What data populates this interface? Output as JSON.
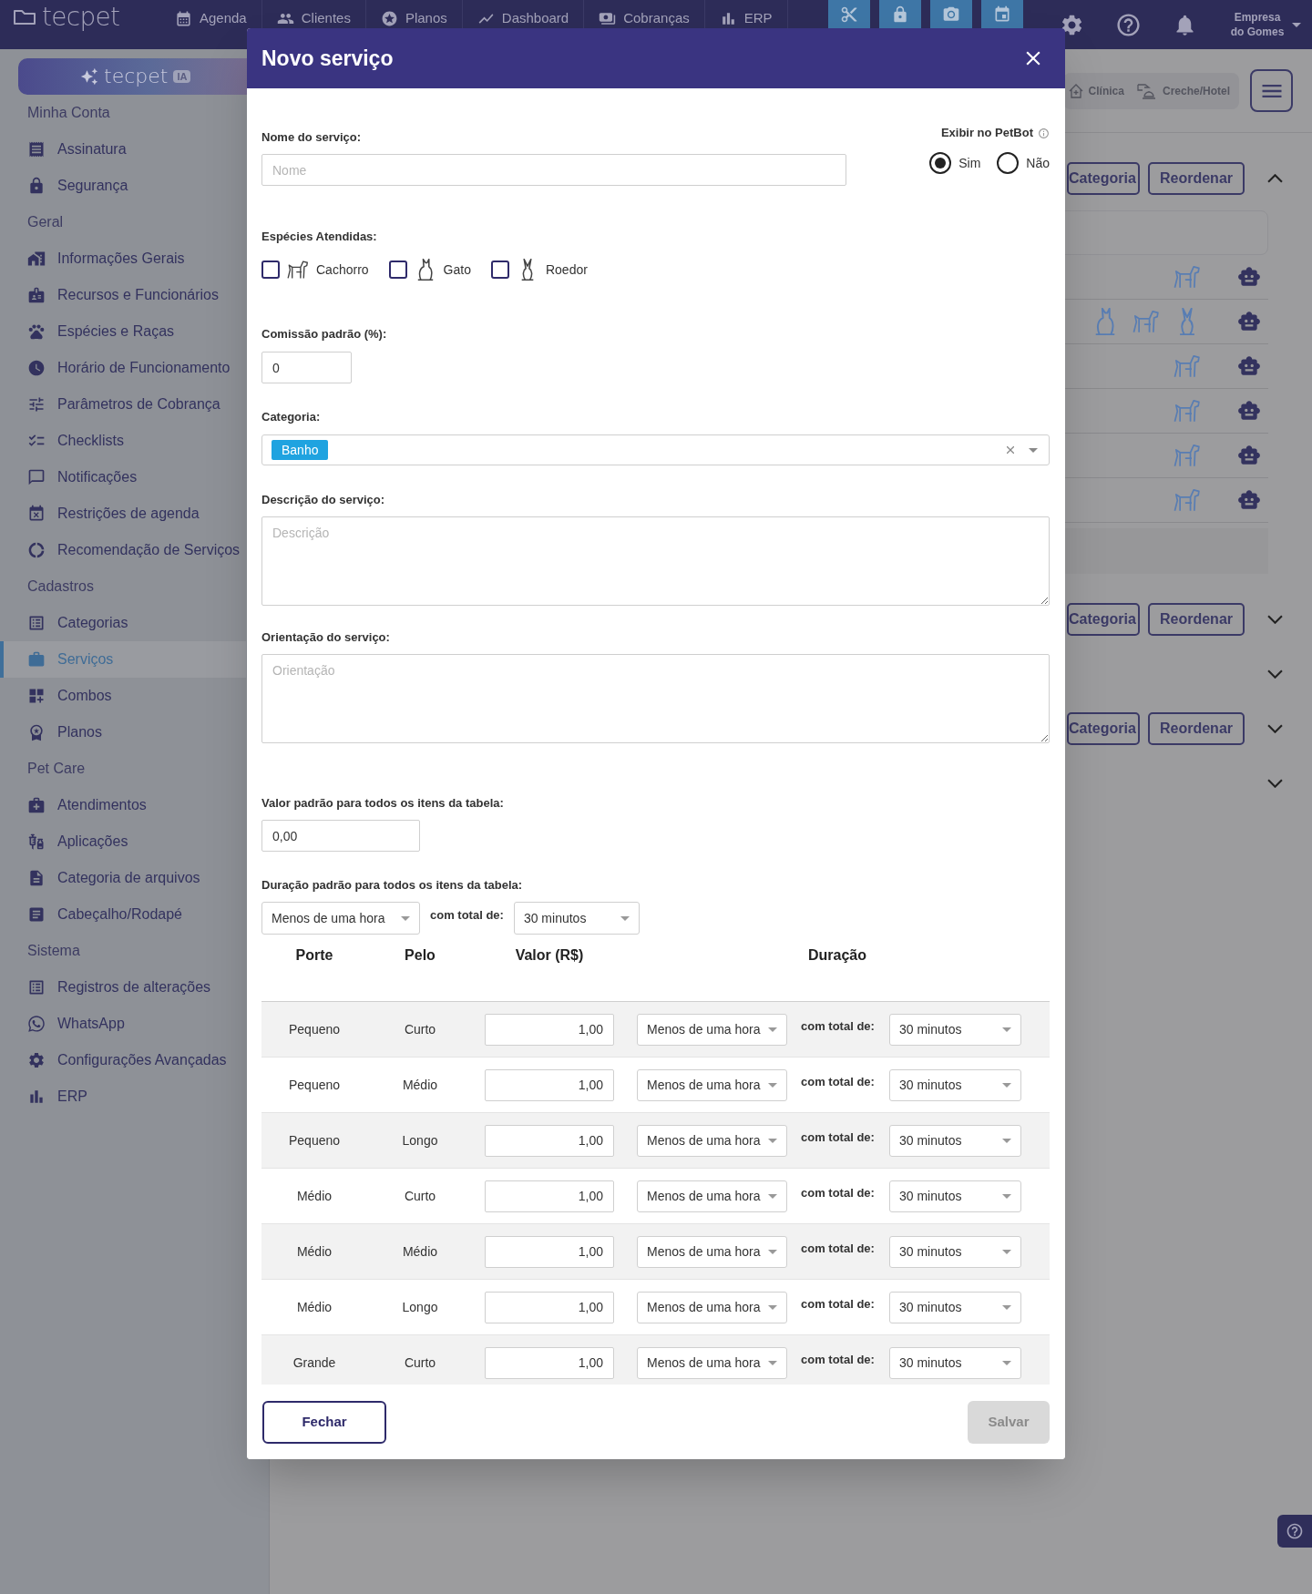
{
  "top_nav": {
    "logo": "tecpet",
    "items": [
      {
        "label": "Agenda"
      },
      {
        "label": "Clientes"
      },
      {
        "label": "Planos"
      },
      {
        "label": "Dashboard"
      },
      {
        "label": "Cobranças"
      },
      {
        "label": "ERP"
      }
    ],
    "company": "Empresa do Gomes"
  },
  "sidebar": {
    "ai_button": "tecpet",
    "ai_badge": "IA",
    "sections": [
      {
        "title": "Minha Conta",
        "items": [
          {
            "label": "Assinatura",
            "selected": false
          },
          {
            "label": "Segurança",
            "selected": false
          }
        ]
      },
      {
        "title": "Geral",
        "items": [
          {
            "label": "Informações Gerais",
            "selected": false
          },
          {
            "label": "Recursos e Funcionários",
            "selected": false
          },
          {
            "label": "Espécies e Raças",
            "selected": false
          },
          {
            "label": "Horário de Funcionamento",
            "selected": false
          },
          {
            "label": "Parâmetros de Cobrança",
            "selected": false
          },
          {
            "label": "Checklists",
            "selected": false
          },
          {
            "label": "Notificações",
            "selected": false
          },
          {
            "label": "Restrições de agenda",
            "selected": false
          },
          {
            "label": "Recomendação de Serviços",
            "selected": false
          }
        ]
      },
      {
        "title": "Cadastros",
        "items": [
          {
            "label": "Categorias",
            "selected": false
          },
          {
            "label": "Serviços",
            "selected": true
          },
          {
            "label": "Combos",
            "selected": false
          },
          {
            "label": "Planos",
            "selected": false
          }
        ]
      },
      {
        "title": "Pet Care",
        "items": [
          {
            "label": "Atendimentos",
            "selected": false
          },
          {
            "label": "Aplicações",
            "selected": false
          },
          {
            "label": "Categoria de arquivos",
            "selected": false
          },
          {
            "label": "Cabeçalho/Rodapé",
            "selected": false
          }
        ]
      },
      {
        "title": "Sistema",
        "items": [
          {
            "label": "Registros de alterações",
            "selected": false
          },
          {
            "label": "WhatsApp",
            "selected": false
          },
          {
            "label": "Configurações Avançadas",
            "selected": false
          },
          {
            "label": "ERP",
            "selected": false
          }
        ]
      }
    ]
  },
  "background": {
    "modes": [
      "Clínica",
      "Creche/Hotel"
    ],
    "sections": [
      {
        "expanded": true,
        "buttons": [
          "Categoria",
          "Reordenar"
        ],
        "rows": [
          {
            "icons": [
              {
                "kind": "dog"
              }
            ]
          },
          {
            "icons": [
              {
                "kind": "cat"
              },
              {
                "kind": "dog"
              },
              {
                "kind": "rodent"
              }
            ]
          },
          {
            "icons": [
              {
                "kind": "dog"
              }
            ]
          },
          {
            "icons": [
              {
                "kind": "dog"
              }
            ]
          },
          {
            "icons": [
              {
                "kind": "dog"
              }
            ]
          },
          {
            "icons": [
              {
                "kind": "dog"
              }
            ]
          }
        ]
      },
      {
        "expanded": false,
        "buttons": [
          "Categoria",
          "Reordenar"
        ]
      },
      {
        "expanded": false
      },
      {
        "expanded": false,
        "buttons": [
          "Categoria",
          "Reordenar"
        ]
      },
      {
        "expanded": false
      }
    ]
  },
  "modal": {
    "title": "Novo serviço",
    "name_field": {
      "label": "Nome do serviço:",
      "placeholder": "Nome"
    },
    "petbot": {
      "label": "Exibir no PetBot",
      "options": [
        {
          "label": "Sim",
          "selected": true
        },
        {
          "label": "Não",
          "selected": false
        }
      ]
    },
    "species": {
      "label": "Espécies Atendidas:",
      "options": [
        {
          "kind": "dog",
          "label": "Cachorro",
          "checked": false
        },
        {
          "kind": "cat",
          "label": "Gato",
          "checked": false
        },
        {
          "kind": "rodent",
          "label": "Roedor",
          "checked": false
        }
      ]
    },
    "commission": {
      "label": "Comissão padrão (%):",
      "value": "0"
    },
    "category": {
      "label": "Categoria:",
      "chips": [
        "Banho"
      ]
    },
    "description": {
      "label": "Descrição do serviço:",
      "placeholder": "Descrição"
    },
    "guidance": {
      "label": "Orientação do serviço:",
      "placeholder": "Orientação"
    },
    "default_price": {
      "label": "Valor padrão para todos os itens da tabela:",
      "value": "0,00"
    },
    "default_duration": {
      "label": "Duração padrão para todos os itens da tabela:",
      "duration": "Menos de uma hora",
      "total_label": "com total de:",
      "total": "30 minutos"
    },
    "table": {
      "columns": [
        "Porte",
        "Pelo",
        "Valor (R$)",
        "Duração"
      ],
      "rows": [
        {
          "porte": "Pequeno",
          "pelo": "Curto",
          "valor": "1,00",
          "duracao": "Menos de uma hora",
          "total_label": "com total de:",
          "total": "30 minutos"
        },
        {
          "porte": "Pequeno",
          "pelo": "Médio",
          "valor": "1,00",
          "duracao": "Menos de uma hora",
          "total_label": "com total de:",
          "total": "30 minutos"
        },
        {
          "porte": "Pequeno",
          "pelo": "Longo",
          "valor": "1,00",
          "duracao": "Menos de uma hora",
          "total_label": "com total de:",
          "total": "30 minutos"
        },
        {
          "porte": "Médio",
          "pelo": "Curto",
          "valor": "1,00",
          "duracao": "Menos de uma hora",
          "total_label": "com total de:",
          "total": "30 minutos"
        },
        {
          "porte": "Médio",
          "pelo": "Médio",
          "valor": "1,00",
          "duracao": "Menos de uma hora",
          "total_label": "com total de:",
          "total": "30 minutos"
        },
        {
          "porte": "Médio",
          "pelo": "Longo",
          "valor": "1,00",
          "duracao": "Menos de uma hora",
          "total_label": "com total de:",
          "total": "30 minutos"
        },
        {
          "porte": "Grande",
          "pelo": "Curto",
          "valor": "1,00",
          "duracao": "Menos de uma hora",
          "total_label": "com total de:",
          "total": "30 minutos"
        }
      ]
    },
    "buttons": [
      {
        "label": "Fechar",
        "kind": "outline",
        "disabled": false
      },
      {
        "label": "Salvar",
        "kind": "filled",
        "disabled": true
      }
    ]
  }
}
